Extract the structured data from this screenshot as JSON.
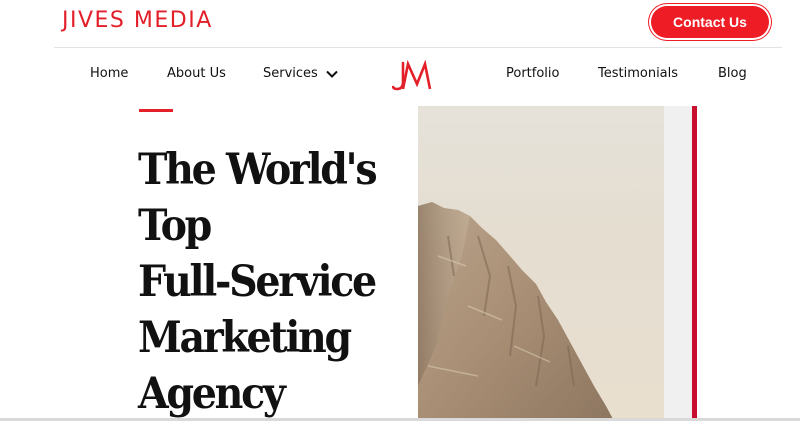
{
  "header": {
    "brand_name": "JIVES MEDIA",
    "contact_button_label": "Contact Us",
    "logo_monogram": "JM"
  },
  "nav": {
    "items": [
      {
        "label": "Home"
      },
      {
        "label": "About Us"
      },
      {
        "label": "Services",
        "has_dropdown": true
      },
      {
        "label": "Portfolio"
      },
      {
        "label": "Testimonials"
      },
      {
        "label": "Blog"
      }
    ]
  },
  "hero": {
    "headline_lines": [
      "The World's",
      "Top",
      "Full-Service",
      "Marketing",
      "Agency"
    ],
    "image_subject": "rocky mountain peak"
  },
  "colors": {
    "brand_red": "#e3202a",
    "button_red": "#ee1c25",
    "accent_bar": "#c8102e",
    "text": "#111111"
  },
  "icons": [
    "chevron-down-icon",
    "jm-logo-icon"
  ]
}
